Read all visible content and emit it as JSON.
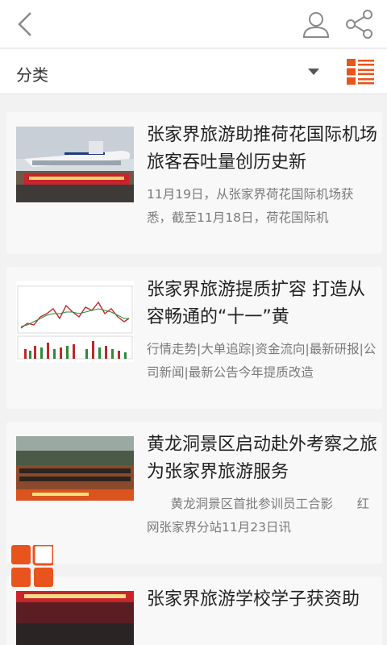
{
  "header": {
    "back": "back-arrow",
    "user": "user-icon",
    "share": "share-icon"
  },
  "category": {
    "label": "分类"
  },
  "accent": "#e8541c",
  "articles": [
    {
      "title": "张家界旅游助推荷花国际机场旅客吞吐量创历史新",
      "desc": "11月19日，从张家界荷花国际机场获悉，截至11月18日，荷花国际机"
    },
    {
      "title": "张家界旅游提质扩容 打造从容畅通的“十一”黄",
      "desc": "行情走势|大单追踪|资金流向|最新研报|公司新闻|最新公告今年提质改造"
    },
    {
      "title": "黄龙洞景区启动赴外考察之旅 为张家界旅游服务",
      "desc": "      黄龙洞景区首批参训员工合影      红网张家界分站11月23日讯"
    },
    {
      "title": "张家界旅游学校学子获资助",
      "desc": ""
    }
  ]
}
